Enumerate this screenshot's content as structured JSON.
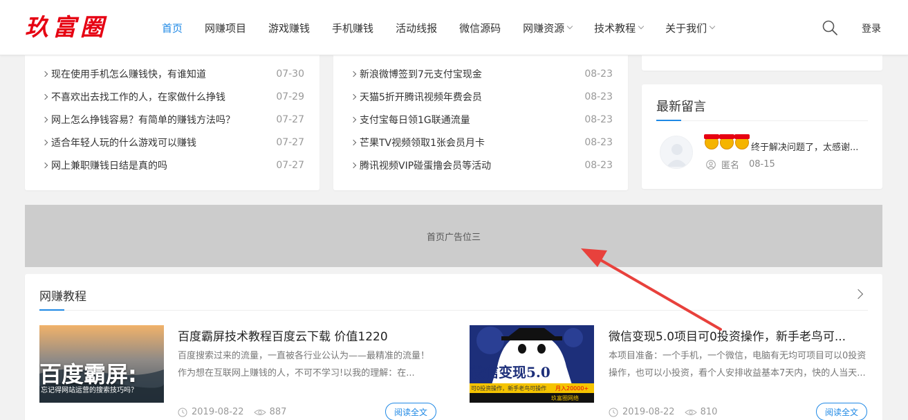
{
  "header": {
    "logo": "玖富圈",
    "nav": [
      {
        "label": "首页",
        "active": true,
        "has_dropdown": false
      },
      {
        "label": "网赚项目",
        "active": false,
        "has_dropdown": false
      },
      {
        "label": "游戏赚钱",
        "active": false,
        "has_dropdown": false
      },
      {
        "label": "手机赚钱",
        "active": false,
        "has_dropdown": false
      },
      {
        "label": "活动线报",
        "active": false,
        "has_dropdown": false
      },
      {
        "label": "微信源码",
        "active": false,
        "has_dropdown": false
      },
      {
        "label": "网赚资源",
        "active": false,
        "has_dropdown": true
      },
      {
        "label": "技术教程",
        "active": false,
        "has_dropdown": true
      },
      {
        "label": "关于我们",
        "active": false,
        "has_dropdown": true
      }
    ],
    "login_label": "登录",
    "search_icon": "search-icon"
  },
  "left_list": [
    {
      "title": "现在使用手机怎么赚钱快，有谁知道",
      "date": "07-30"
    },
    {
      "title": "不喜欢出去找工作的人，在家做什么挣钱",
      "date": "07-29"
    },
    {
      "title": "网上怎么挣钱容易？有简单的赚钱方法吗？",
      "date": "07-27"
    },
    {
      "title": "适合年轻人玩的什么游戏可以赚钱",
      "date": "07-27"
    },
    {
      "title": "网上兼职赚钱日结是真的吗",
      "date": "07-27"
    }
  ],
  "middle_list": [
    {
      "title": "新浪微博签到7元支付宝现金",
      "date": "08-23"
    },
    {
      "title": "天猫5折开腾讯视频年费会员",
      "date": "08-23"
    },
    {
      "title": "支付宝每日领1G联通流量",
      "date": "08-23"
    },
    {
      "title": "芒果TV视频领取1张会员月卡",
      "date": "08-23"
    },
    {
      "title": "腾讯视频VIP碰蛋撸会员等活动",
      "date": "08-23"
    }
  ],
  "latest_messages": {
    "title": "最新留言",
    "items": [
      {
        "text": "终于解决问题了，太感谢...",
        "author": "匿名",
        "date": "08-15"
      }
    ]
  },
  "ad": {
    "label": "首页广告位三"
  },
  "tutorials": {
    "title": "网赚教程",
    "posts": [
      {
        "title": "百度霸屏技术教程百度云下载 价值1220",
        "excerpt": "百度搜索过来的流量，一直被各行业公认为——最精准的流量！作为想在互联网上赚钱的人，不可不学习!以我的理解：在...",
        "date": "2019-08-22",
        "views": "887",
        "read_label": "阅读全文",
        "thumb_text_main": "百度霸屏:",
        "thumb_text_sub": "忘记得网站运营的搜索技巧吗？"
      },
      {
        "title": "微信变现5.0项目可0投资操作，新手老鸟可...",
        "excerpt": "本项目准备：一个手机，一个微信，电脑有无均可项目可以0投资操作，也可以小投资，看个人安排收益基本7天内，快的人当天...",
        "date": "2019-08-22",
        "views": "810",
        "read_label": "阅读全文",
        "thumb_text_main": "微信变现5.0",
        "thumb_text_sub": "可0投资操作，新手老鸟可操作",
        "thumb_text_extra": "月入20000+",
        "thumb_text_brand": "玖富圈网络"
      }
    ]
  },
  "colors": {
    "accent": "#1e88e5",
    "logo": "#e60012",
    "annotation_arrow": "#e8413c",
    "ad_bg": "#cccccc"
  }
}
